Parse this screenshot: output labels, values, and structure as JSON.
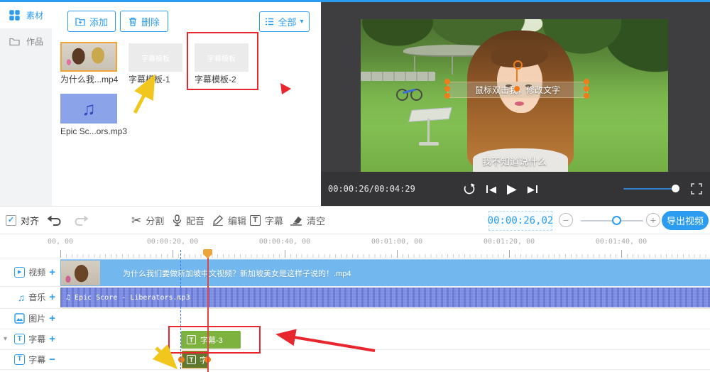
{
  "colors": {
    "accent": "#2b9cf0",
    "video_clip": "#72b7ee",
    "music_clip": "#7e8ee4",
    "subtitle_clip": "#7cb23d",
    "subtitle_clip_selected": "#5f7a30",
    "annotation_red": "#e8262d",
    "annotation_yellow": "#f2c71d",
    "selection_orange": "#f07d1a"
  },
  "library": {
    "tabs": [
      {
        "label": "素材"
      },
      {
        "label": "作品"
      }
    ],
    "add_label": "添加",
    "delete_label": "删除",
    "filter_label": "全部",
    "items": [
      {
        "label": "为什么我...mp4"
      },
      {
        "label": "字幕模板-1",
        "thumb_text": "字幕模板"
      },
      {
        "label": "字幕模板-2",
        "thumb_text": "字幕模板"
      },
      {
        "label": "Epic Sc...ors.mp3"
      }
    ]
  },
  "preview": {
    "overlay_text": "鼠标双击我，修改文字",
    "subtitle": "我不知道说什么",
    "player": {
      "time": "00:00:26/00:04:29"
    }
  },
  "toolbar": {
    "align_label": "对齐",
    "split_label": "分割",
    "dub_label": "配音",
    "edit_label": "编辑",
    "subtitle_label": "字幕",
    "clear_label": "清空",
    "timecode": "00:00:26,02",
    "export_label": "导出视频"
  },
  "timeline": {
    "ruler": [
      "00, 00",
      "00:00:20, 00",
      "00:00:40, 00",
      "00:01:00, 00",
      "00:01:20, 00",
      "00:01:40, 00"
    ],
    "tracks": [
      {
        "label": "视频",
        "action": "+"
      },
      {
        "label": "音乐",
        "action": "+"
      },
      {
        "label": "图片",
        "action": "+"
      },
      {
        "label": "字幕",
        "action": "+"
      },
      {
        "label": "字幕",
        "action": "−"
      }
    ],
    "clips": {
      "video_label": "为什么我们要做新加坡中文视频？新加坡美女是这样子说的！.mp4",
      "music_label": "Epic Score - Liberators.mp3",
      "subtitle_label": "字幕-3",
      "subtitle2_label": "字"
    }
  },
  "icons": {
    "check": "✓",
    "caret_down": "▾",
    "scissors": "✂",
    "music_note": "♫",
    "play": "▶",
    "prev": "◀",
    "next": "▶",
    "t_letter": "T",
    "zoom_out": "−",
    "zoom_in": "+"
  }
}
